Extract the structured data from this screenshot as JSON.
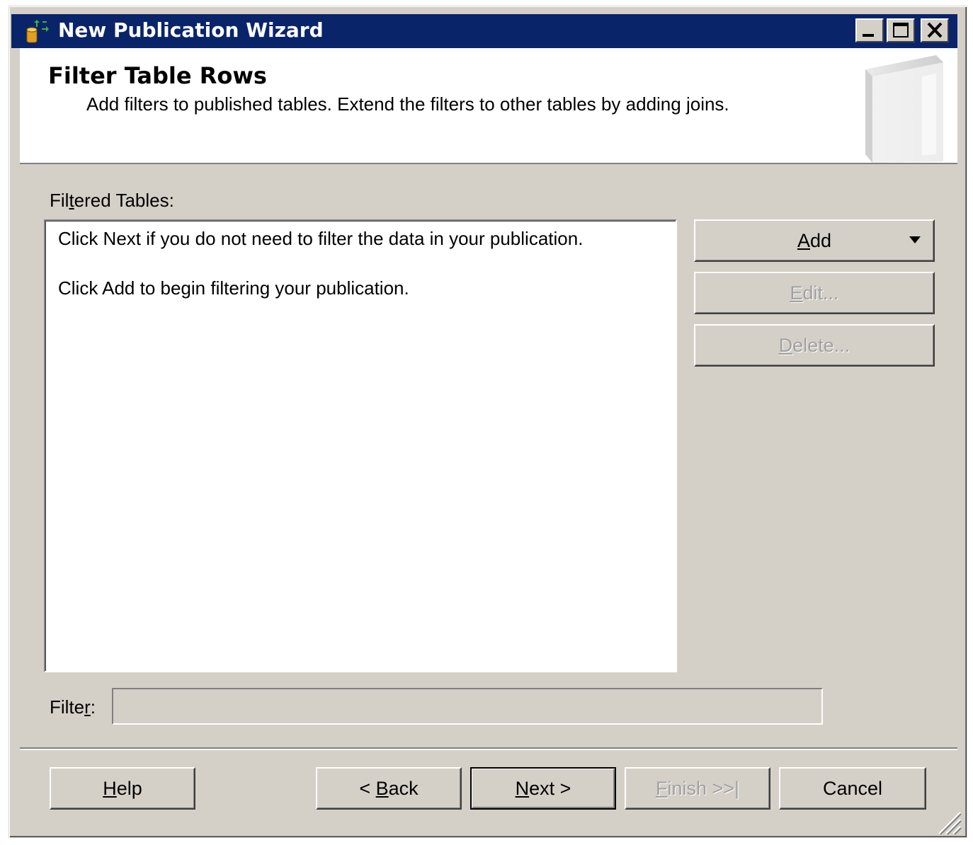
{
  "window": {
    "title": "New Publication Wizard",
    "icon": "publication-wizard-icon"
  },
  "header": {
    "title": "Filter Table Rows",
    "subtitle": "Add filters to published tables. Extend the filters to other tables by adding joins."
  },
  "filtered_tables": {
    "label_pre": "Fil",
    "label_u": "t",
    "label_post": "ered Tables:",
    "lines": [
      "Click Next if you do not need to filter the data in your publication.",
      "Click Add to begin filtering your publication."
    ]
  },
  "side_buttons": {
    "add": {
      "u": "A",
      "rest": "dd"
    },
    "edit": {
      "u": "E",
      "rest": "dit..."
    },
    "delete": {
      "u": "D",
      "rest": "elete..."
    }
  },
  "filter": {
    "label_pre": "Filte",
    "label_u": "r",
    "label_post": ":",
    "value": ""
  },
  "footer_buttons": {
    "help": {
      "pre": "",
      "u": "H",
      "rest": "elp"
    },
    "back": {
      "pre": "< ",
      "u": "B",
      "rest": "ack"
    },
    "next": {
      "pre": "",
      "u": "N",
      "rest": "ext >"
    },
    "finish": {
      "pre": "",
      "u": "F",
      "rest": "inish >>|"
    },
    "cancel": {
      "label": "Cancel"
    }
  },
  "colors": {
    "titlebar": "#0a246a",
    "face": "#d4d0c8",
    "disabled_text": "#a0a0a0"
  }
}
